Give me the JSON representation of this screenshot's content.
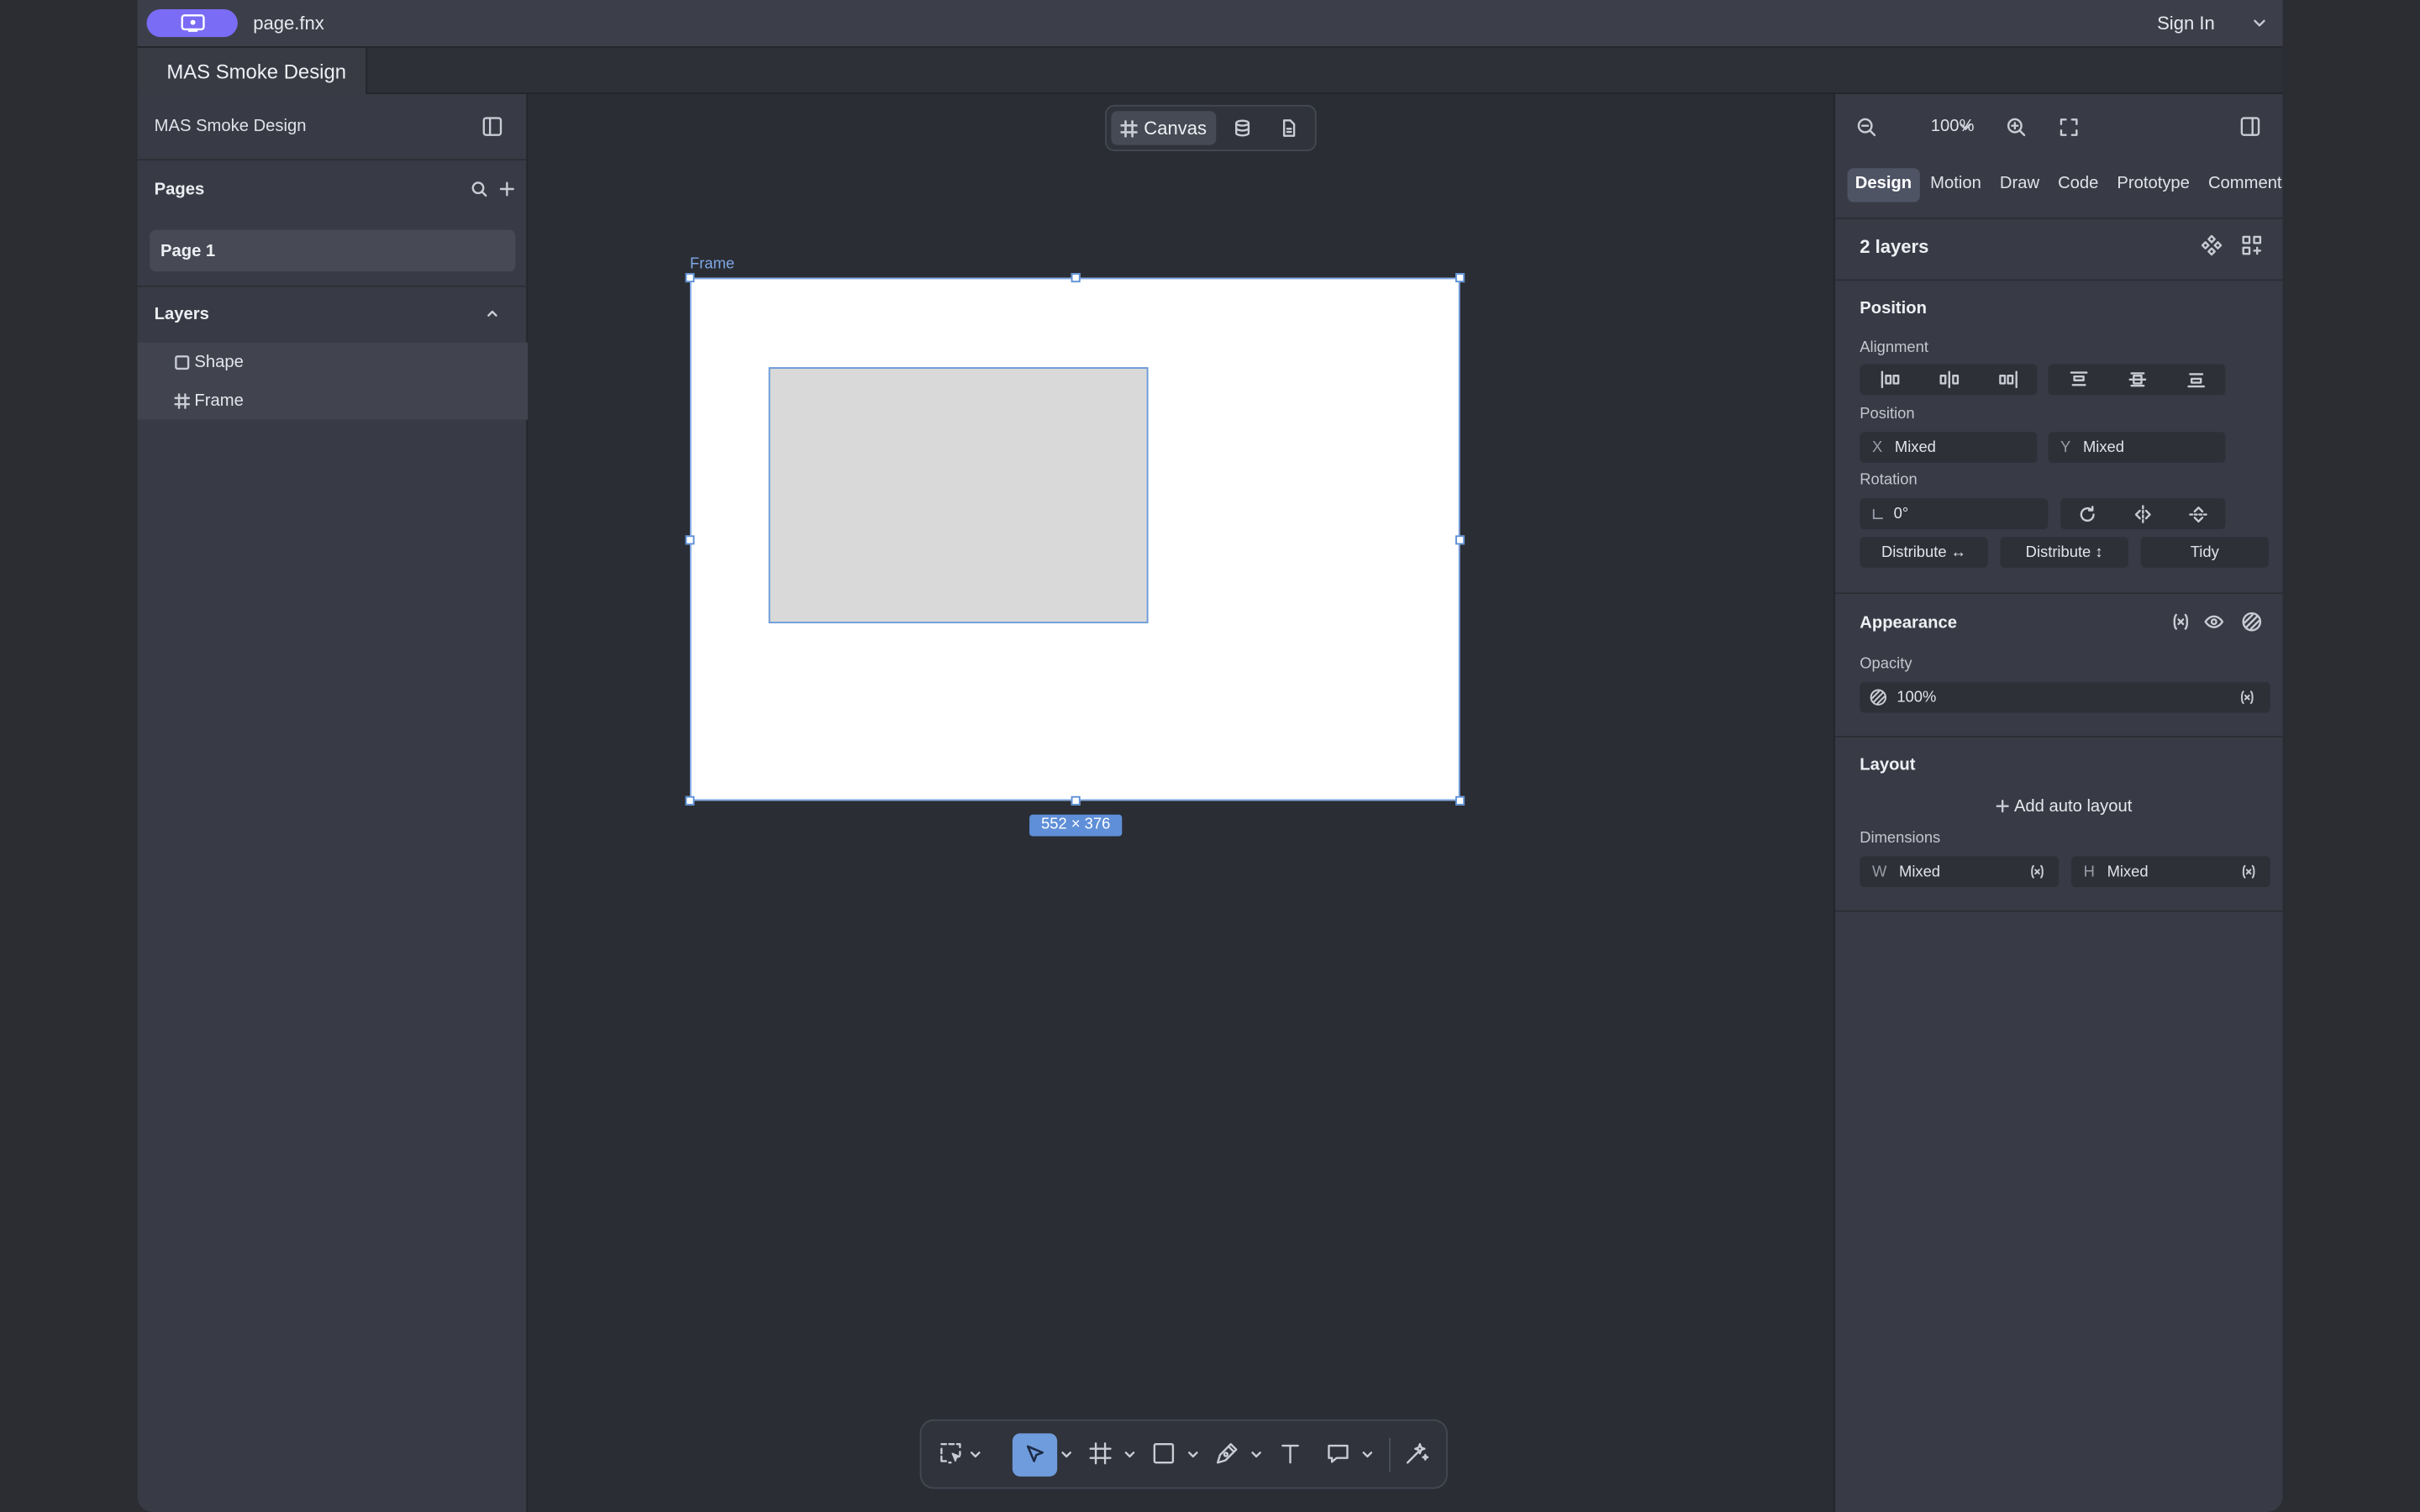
{
  "titlebar": {
    "filename": "page.fnx",
    "signin": "Sign In"
  },
  "tabs": {
    "document_tab": "MAS Smoke Design"
  },
  "left_panel": {
    "project_title": "MAS Smoke Design",
    "pages_title": "Pages",
    "pages": [
      {
        "label": "Page 1"
      }
    ],
    "layers_title": "Layers",
    "layers": [
      {
        "label": "Shape",
        "icon": "square-icon"
      },
      {
        "label": "Frame",
        "icon": "frame-icon"
      }
    ]
  },
  "canvas": {
    "switch_label": "Canvas",
    "frame_label": "Frame",
    "dimensions": "552 × 376"
  },
  "right_panel": {
    "zoom": "100%",
    "tabs": [
      {
        "label": "Design",
        "active": true
      },
      {
        "label": "Motion"
      },
      {
        "label": "Draw"
      },
      {
        "label": "Code"
      },
      {
        "label": "Prototype"
      },
      {
        "label": "Comments"
      }
    ],
    "selection_title": "2 layers",
    "position": {
      "title": "Position",
      "alignment_label": "Alignment",
      "position_label": "Position",
      "x_prefix": "X",
      "x_value": "Mixed",
      "y_prefix": "Y",
      "y_value": "Mixed",
      "rotation_label": "Rotation",
      "rotation_value": "0°",
      "distribute_h": "Distribute ↔",
      "distribute_v": "Distribute ↕",
      "tidy": "Tidy"
    },
    "appearance": {
      "title": "Appearance",
      "opacity_label": "Opacity",
      "opacity_value": "100%"
    },
    "layout": {
      "title": "Layout",
      "add_auto_layout": "Add auto layout",
      "dimensions_label": "Dimensions",
      "w_prefix": "W",
      "w_value": "Mixed",
      "h_prefix": "H",
      "h_value": "Mixed"
    }
  },
  "colors": {
    "accent": "#7a6cf5",
    "selection": "#6f9cdc",
    "panel": "#383b45",
    "canvas": "#2a2d34"
  }
}
